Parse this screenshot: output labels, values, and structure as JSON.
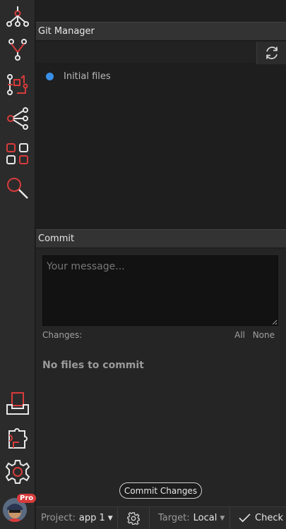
{
  "sidebar": {
    "icons": [
      {
        "name": "hierarchy-icon"
      },
      {
        "name": "branch-merge-icon"
      },
      {
        "name": "pull-request-icon"
      },
      {
        "name": "share-nodes-icon"
      },
      {
        "name": "grid-icon"
      },
      {
        "name": "search-icon"
      },
      {
        "name": "inbox-icon"
      },
      {
        "name": "puzzle-icon"
      },
      {
        "name": "gear-icon"
      }
    ],
    "pro_badge": "Pro",
    "accent_color": "#d83b3b",
    "icon_color": "#e8e8e8"
  },
  "git_manager": {
    "title": "Git Manager",
    "commits": [
      {
        "label": "Initial files",
        "dot_color": "#3a8fe8"
      }
    ]
  },
  "commit": {
    "title": "Commit",
    "message_placeholder": "Your message...",
    "changes_label": "Changes:",
    "all_label": "All",
    "none_label": "None",
    "empty_text": "No files to commit",
    "commit_button": "Commit Changes"
  },
  "statusbar": {
    "project_label": "Project:",
    "project_value": "app 1",
    "target_label": "Target:",
    "target_value": "Local",
    "check_label": "Check"
  }
}
